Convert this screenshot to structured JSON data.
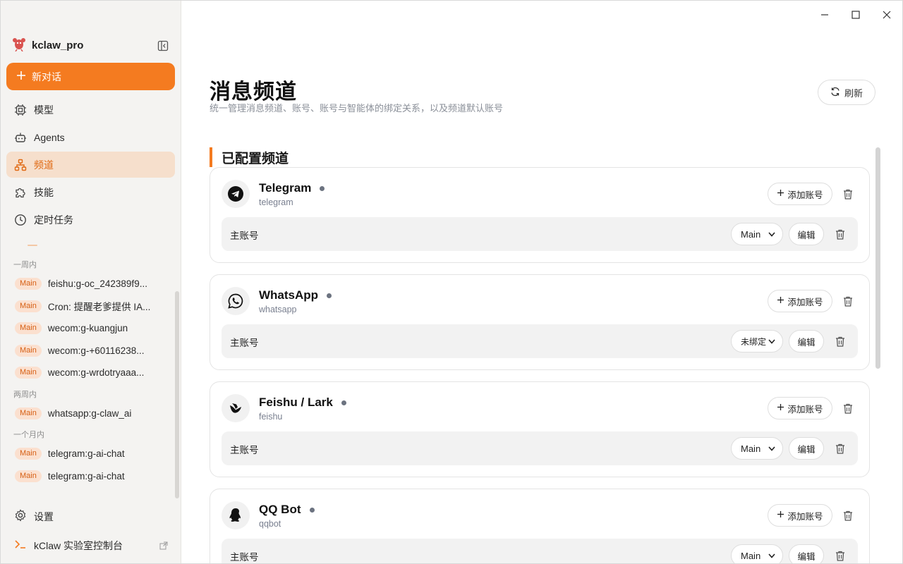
{
  "window": {
    "minimize_icon": "minimize-icon",
    "maximize_icon": "maximize-icon",
    "close_icon": "close-icon"
  },
  "sidebar": {
    "app_name": "kclaw_pro",
    "new_chat_label": "新对话",
    "nav": [
      {
        "label": "模型",
        "icon": "chip-icon"
      },
      {
        "label": "Agents",
        "icon": "bot-icon"
      },
      {
        "label": "频道",
        "icon": "network-icon",
        "active": true
      },
      {
        "label": "技能",
        "icon": "puzzle-icon"
      },
      {
        "label": "定时任务",
        "icon": "clock-icon"
      }
    ],
    "history": {
      "groups": [
        {
          "label": "一周内",
          "items": [
            {
              "tag": "Main",
              "title": "feishu:g-oc_242389f9..."
            },
            {
              "tag": "Main",
              "title": "Cron: 提醒老爹提供 IA..."
            },
            {
              "tag": "Main",
              "title": "wecom:g-kuangjun"
            },
            {
              "tag": "Main",
              "title": "wecom:g-+60116238..."
            },
            {
              "tag": "Main",
              "title": "wecom:g-wrdotryaaa..."
            }
          ]
        },
        {
          "label": "两周内",
          "items": [
            {
              "tag": "Main",
              "title": "whatsapp:g-claw_ai"
            }
          ]
        },
        {
          "label": "一个月内",
          "items": [
            {
              "tag": "Main",
              "title": "telegram:g-ai-chat"
            },
            {
              "tag": "Main",
              "title": "telegram:g-ai-chat"
            }
          ]
        }
      ]
    },
    "settings_label": "设置",
    "console_label": "kClaw 实验室控制台"
  },
  "main": {
    "title": "消息频道",
    "subtitle": "统一管理消息频道、账号、账号与智能体的绑定关系，以及频道默认账号",
    "refresh_label": "刷新",
    "section_title": "已配置频道",
    "channels": [
      {
        "name": "Telegram",
        "code": "telegram",
        "icon": "telegram-icon",
        "add_label": "添加账号",
        "account_label": "主账号",
        "agent": "Main",
        "edit_label": "编辑"
      },
      {
        "name": "WhatsApp",
        "code": "whatsapp",
        "icon": "whatsapp-icon",
        "add_label": "添加账号",
        "account_label": "主账号",
        "agent": "未绑定",
        "edit_label": "编辑"
      },
      {
        "name": "Feishu / Lark",
        "code": "feishu",
        "icon": "feishu-icon",
        "add_label": "添加账号",
        "account_label": "主账号",
        "agent": "Main",
        "edit_label": "编辑"
      },
      {
        "name": "QQ Bot",
        "code": "qqbot",
        "icon": "qq-icon",
        "add_label": "添加账号",
        "account_label": "主账号",
        "agent": "Main",
        "edit_label": "编辑"
      }
    ]
  },
  "colors": {
    "accent": "#f47b20",
    "active_nav_bg": "#f6dfcc",
    "sidebar_bg": "#f4f3f1",
    "status_dot": "#6c7380"
  }
}
